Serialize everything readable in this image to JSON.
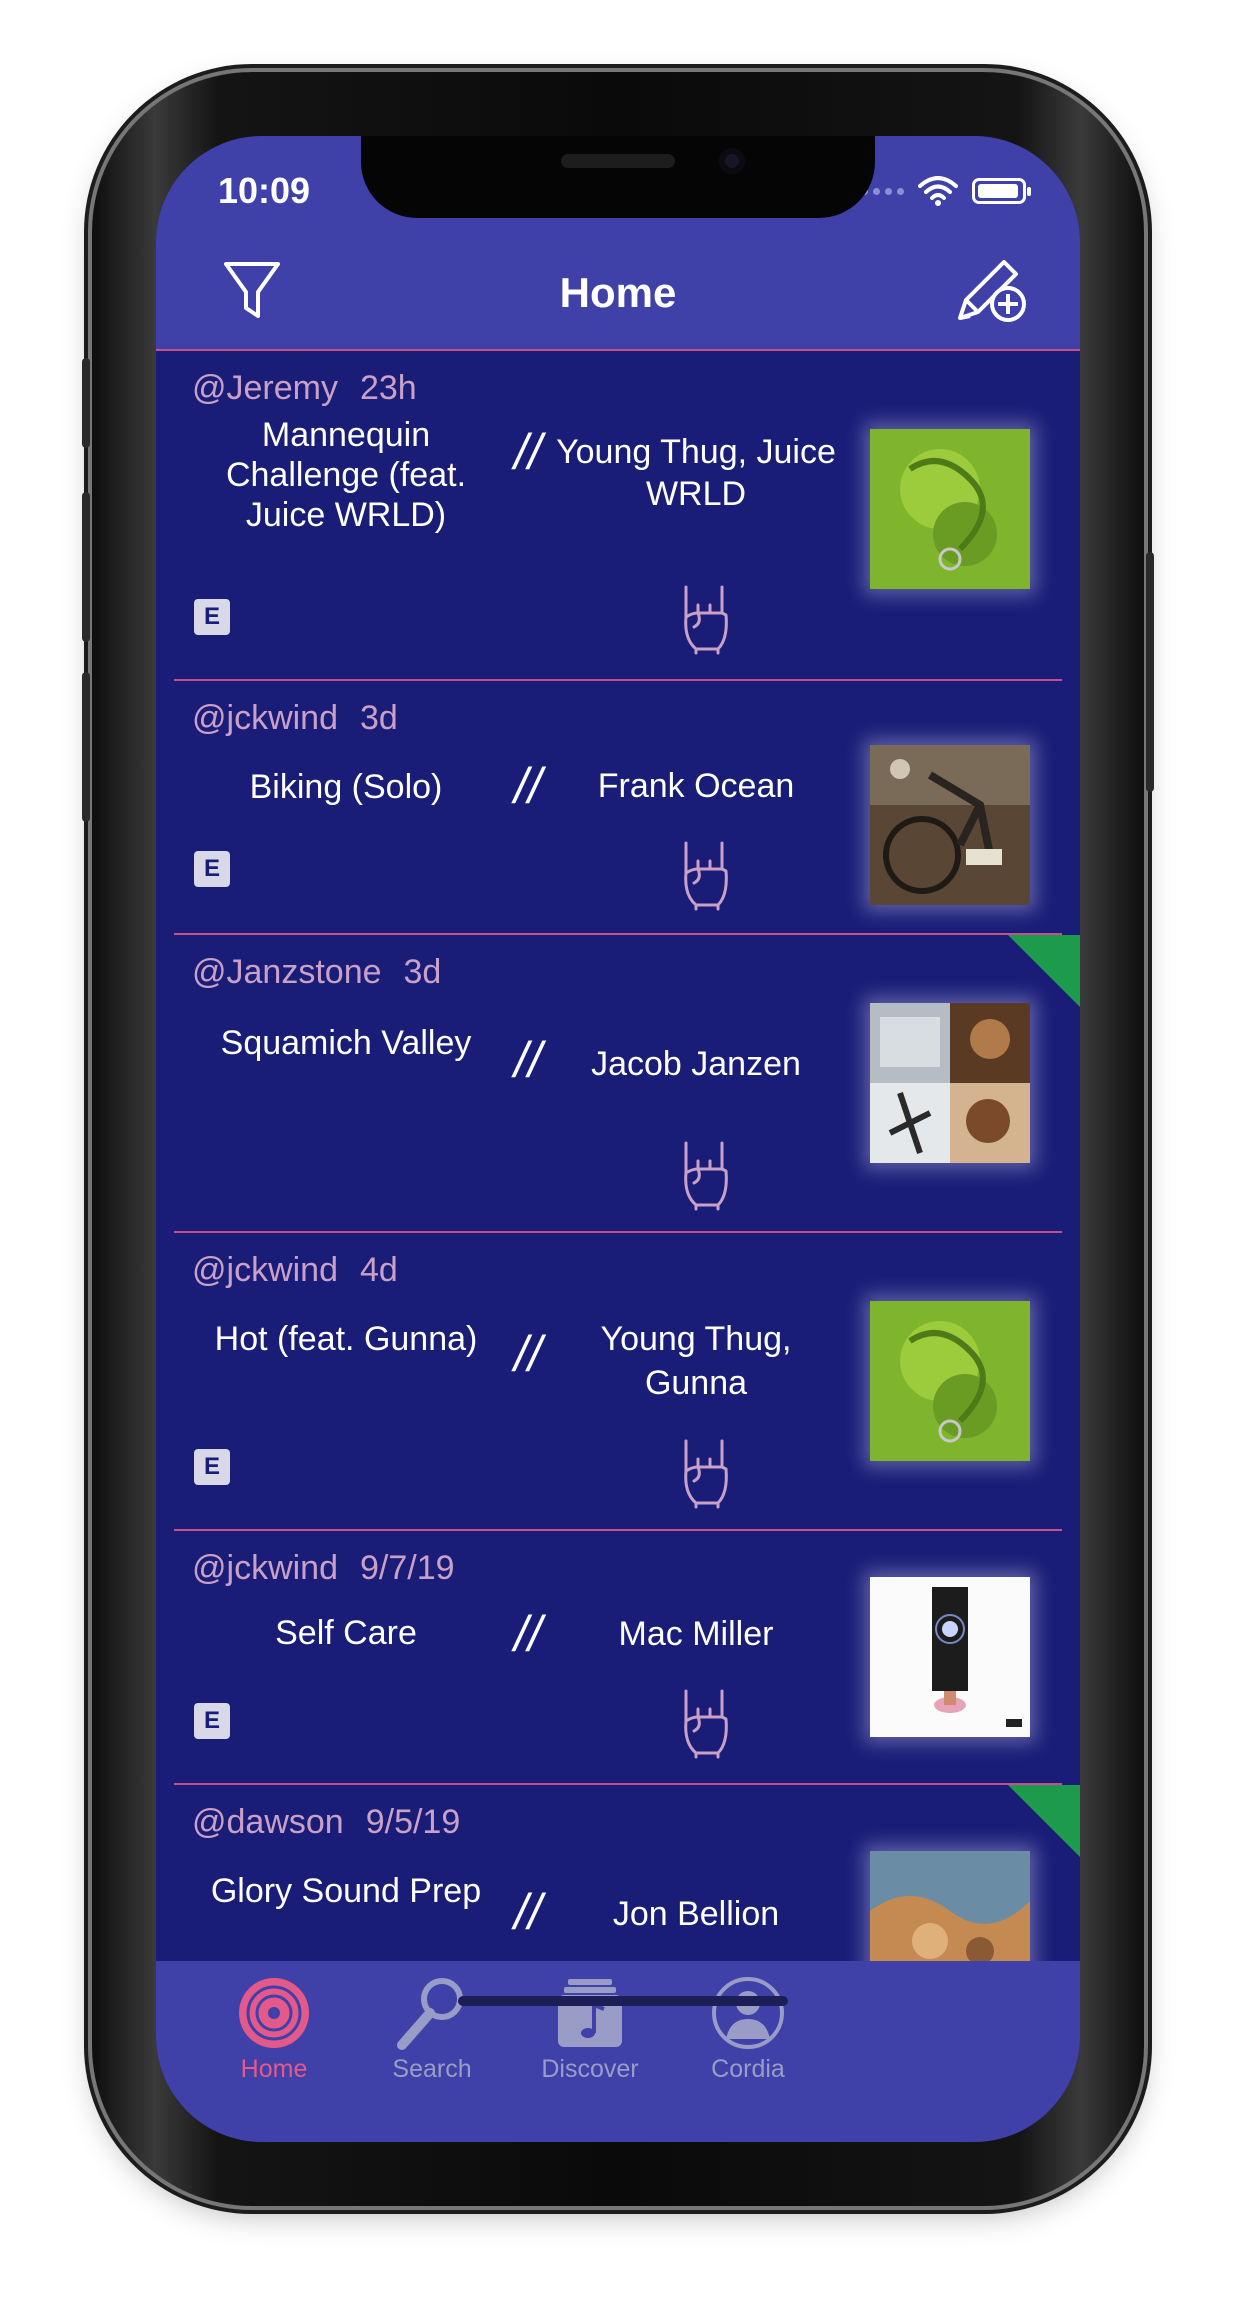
{
  "status_bar": {
    "time": "10:09"
  },
  "nav": {
    "title": "Home"
  },
  "feed": [
    {
      "user": "@Jeremy",
      "time": "23h",
      "song": "Mannequin Challenge (feat. Juice WRLD)",
      "separator": "//",
      "artist": "Young Thug, Juice WRLD",
      "explicit": "E",
      "art": "green"
    },
    {
      "user": "@jckwind",
      "time": "3d",
      "song": "Biking (Solo)",
      "separator": "//",
      "artist": "Frank Ocean",
      "explicit": "E",
      "art": "bike"
    },
    {
      "user": "@Janzstone",
      "time": "3d",
      "song": "Squamich Valley",
      "separator": "//",
      "artist": "Jacob Janzen",
      "explicit": "",
      "art": "collage"
    },
    {
      "user": "@jckwind",
      "time": "4d",
      "song": "Hot (feat. Gunna)",
      "separator": "//",
      "artist": "Young Thug, Gunna",
      "explicit": "E",
      "art": "green"
    },
    {
      "user": "@jckwind",
      "time": "9/7/19",
      "song": "Self Care",
      "separator": "//",
      "artist": "Mac Miller",
      "explicit": "E",
      "art": "white"
    },
    {
      "user": "@dawson",
      "time": "9/5/19",
      "song": "Glory Sound Prep",
      "separator": "//",
      "artist": "Jon Bellion",
      "explicit": "",
      "art": "orange"
    }
  ],
  "tabs": [
    {
      "label": "Home",
      "icon": "vinyl-record-icon"
    },
    {
      "label": "Search",
      "icon": "magnifier-icon"
    },
    {
      "label": "Discover",
      "icon": "music-stack-icon"
    },
    {
      "label": "Cordia",
      "icon": "profile-icon"
    }
  ],
  "colors": {
    "navy": "#1a1d78",
    "bar": "#3f41a8",
    "accent": "#e35a8a",
    "divider": "#c8508a",
    "new_badge": "#1e9a4d"
  }
}
